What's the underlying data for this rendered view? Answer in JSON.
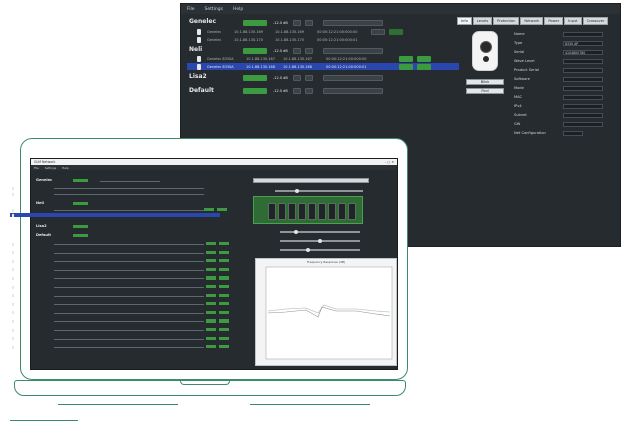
{
  "big_window": {
    "menu": [
      "File",
      "Settings",
      "Help"
    ],
    "groups": [
      {
        "name": "Genelec",
        "y": 20
      },
      {
        "name": "Neli",
        "y": 44
      },
      {
        "name": "Lisa2",
        "y": 71
      },
      {
        "name": "Default",
        "y": 85
      }
    ],
    "tabs": [
      "Info",
      "Levels",
      "Protection",
      "Network",
      "Power",
      "Input",
      "Crossover"
    ],
    "speaker_buttons": [
      "Blink",
      "Find"
    ],
    "info_labels": [
      "Name",
      "Type",
      "Serial",
      "Wave Level",
      "Product Serial",
      "Software",
      "Mode",
      "MAC",
      "IPv4",
      "Subnet",
      "GW",
      "Net Configuration"
    ],
    "info_values": [
      "",
      "8330 AP",
      "4104800780",
      "",
      "",
      "",
      "",
      "",
      "",
      "",
      "",
      ""
    ]
  },
  "laptop_window": {
    "title": "GLM Network",
    "menu": [
      "File",
      "Settings",
      "Help"
    ],
    "groups": [
      "Genelec",
      "Neli",
      "Lisa2",
      "Default"
    ],
    "plot_title": "Frequency Response (dB)"
  },
  "colors": {
    "accent_green": "#3c9a41",
    "selection_blue": "#2a47b0",
    "panel_dark": "#262b2f",
    "outline_teal": "#3d8a6f"
  }
}
